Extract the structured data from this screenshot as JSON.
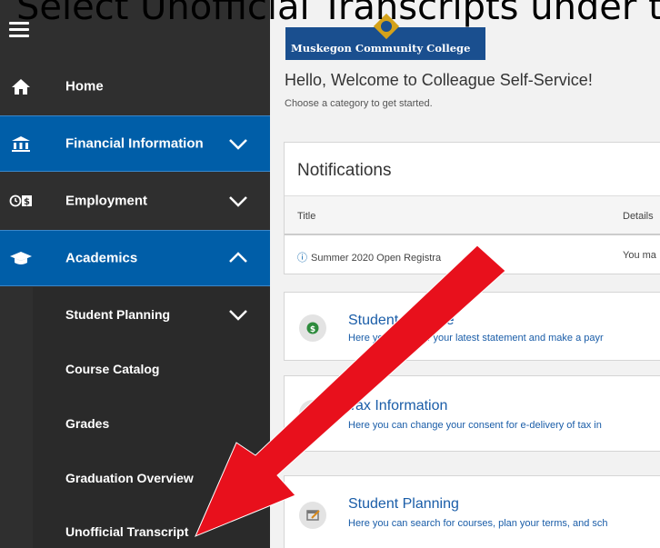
{
  "caption": "Select Unofficial Transcripts under the",
  "logo": {
    "text": "Muskegon Community College"
  },
  "sidebar": {
    "menu_icon": "hamburger-menu-icon",
    "items": [
      {
        "label": "Home",
        "icon": "home-icon"
      },
      {
        "label": "Financial Information",
        "icon": "bank-icon"
      },
      {
        "label": "Employment",
        "icon": "clock-dollar-icon"
      },
      {
        "label": "Academics",
        "icon": "graduation-cap-icon"
      }
    ],
    "academics_sub": [
      {
        "label": "Student Planning"
      },
      {
        "label": "Course Catalog"
      },
      {
        "label": "Grades"
      },
      {
        "label": "Graduation Overview"
      },
      {
        "label": "Unofficial Transcript"
      }
    ]
  },
  "main": {
    "welcome": "Hello, Welcome to Colleague Self-Service!",
    "subtitle": "Choose a category to get started.",
    "notifications": {
      "title": "Notifications",
      "columns": [
        "Title",
        "Details"
      ],
      "rows": [
        {
          "title": "Summer 2020 Open Registra",
          "details": "You ma"
        }
      ]
    },
    "categories": [
      {
        "title": "Student Finance",
        "desc": "Here you can view your latest statement and make a payr",
        "icon": "dollar-icon"
      },
      {
        "title": "Tax Information",
        "desc": "Here you can change your consent for e-delivery of tax in",
        "icon": "tax-icon"
      },
      {
        "title": "Student Planning",
        "desc": "Here you can search for courses, plan your terms, and sch",
        "icon": "calendar-icon"
      }
    ]
  },
  "colors": {
    "sidebar": "#2f2f2f",
    "active": "#005ea8",
    "link": "#1a5da8",
    "arrow": "#e8101c"
  }
}
